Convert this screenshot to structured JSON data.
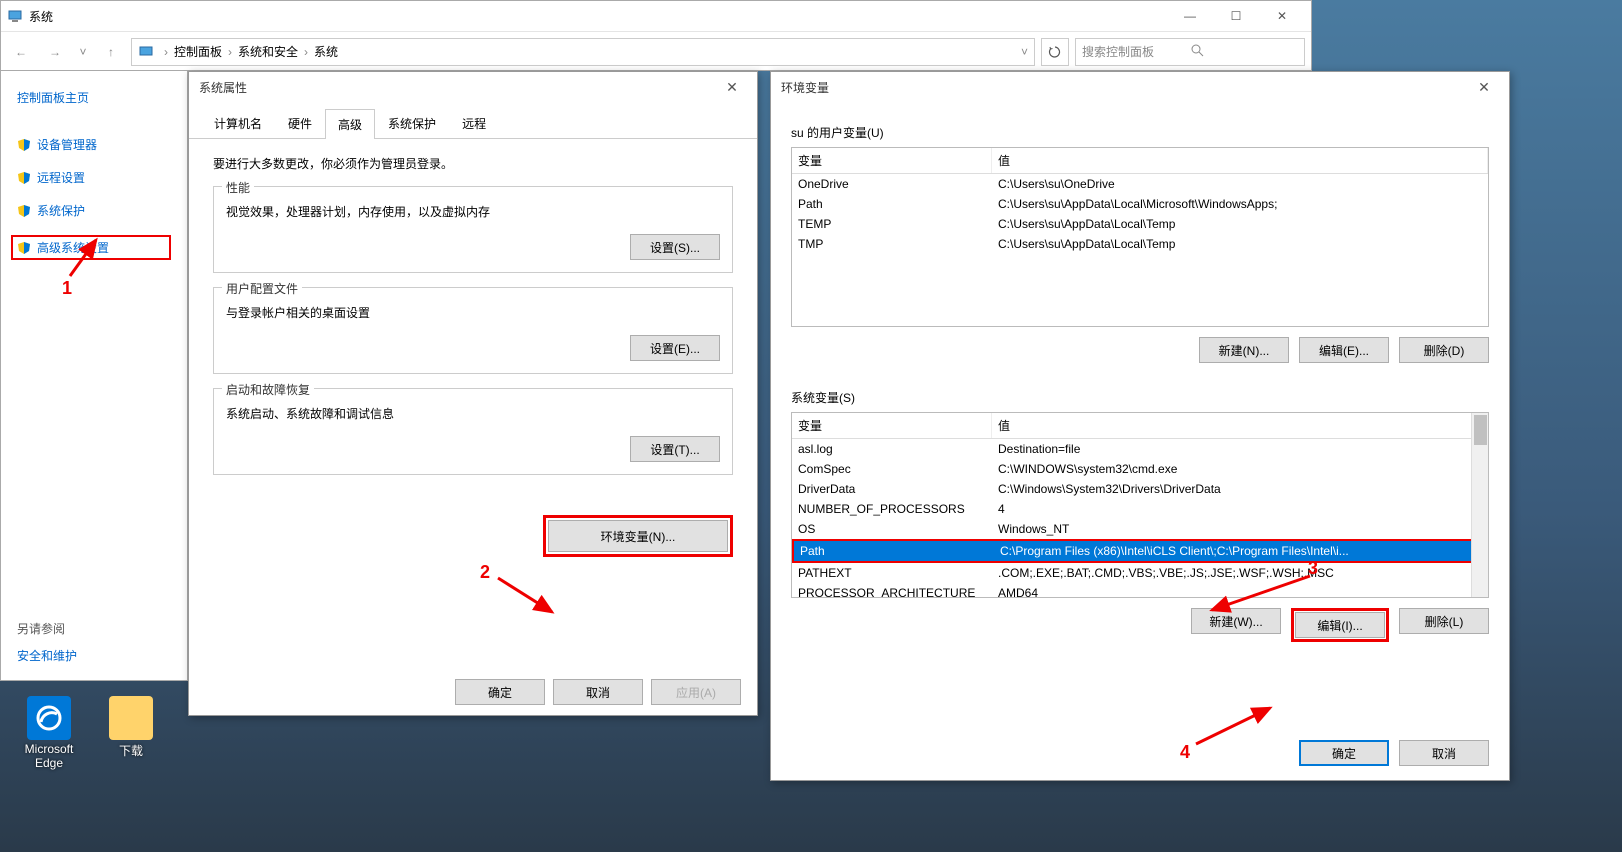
{
  "cp": {
    "title": "系统",
    "breadcrumb": [
      "控制面板",
      "系统和安全",
      "系统"
    ],
    "search_placeholder": "搜索控制面板"
  },
  "sidebar": {
    "home": "控制面板主页",
    "items": [
      {
        "label": "设备管理器"
      },
      {
        "label": "远程设置"
      },
      {
        "label": "系统保护"
      },
      {
        "label": "高级系统设置"
      }
    ],
    "footer_title": "另请参阅",
    "footer_link": "安全和维护"
  },
  "sp": {
    "title": "系统属性",
    "tabs": [
      "计算机名",
      "硬件",
      "高级",
      "系统保护",
      "远程"
    ],
    "note": "要进行大多数更改，你必须作为管理员登录。",
    "group1": {
      "legend": "性能",
      "desc": "视觉效果，处理器计划，内存使用，以及虚拟内存",
      "btn": "设置(S)..."
    },
    "group2": {
      "legend": "用户配置文件",
      "desc": "与登录帐户相关的桌面设置",
      "btn": "设置(E)..."
    },
    "group3": {
      "legend": "启动和故障恢复",
      "desc": "系统启动、系统故障和调试信息",
      "btn": "设置(T)..."
    },
    "env_btn": "环境变量(N)...",
    "ok": "确定",
    "cancel": "取消",
    "apply": "应用(A)"
  },
  "ev": {
    "title": "环境变量",
    "user_label": "su 的用户变量(U)",
    "sys_label": "系统变量(S)",
    "th_var": "变量",
    "th_val": "值",
    "user_rows": [
      {
        "var": "OneDrive",
        "val": "C:\\Users\\su\\OneDrive"
      },
      {
        "var": "Path",
        "val": "C:\\Users\\su\\AppData\\Local\\Microsoft\\WindowsApps;"
      },
      {
        "var": "TEMP",
        "val": "C:\\Users\\su\\AppData\\Local\\Temp"
      },
      {
        "var": "TMP",
        "val": "C:\\Users\\su\\AppData\\Local\\Temp"
      }
    ],
    "sys_rows": [
      {
        "var": "asl.log",
        "val": "Destination=file"
      },
      {
        "var": "ComSpec",
        "val": "C:\\WINDOWS\\system32\\cmd.exe"
      },
      {
        "var": "DriverData",
        "val": "C:\\Windows\\System32\\Drivers\\DriverData"
      },
      {
        "var": "NUMBER_OF_PROCESSORS",
        "val": "4"
      },
      {
        "var": "OS",
        "val": "Windows_NT"
      },
      {
        "var": "Path",
        "val": "C:\\Program Files (x86)\\Intel\\iCLS Client\\;C:\\Program Files\\Intel\\i..."
      },
      {
        "var": "PATHEXT",
        "val": ".COM;.EXE;.BAT;.CMD;.VBS;.VBE;.JS;.JSE;.WSF;.WSH;.MSC"
      },
      {
        "var": "PROCESSOR_ARCHITECTURE",
        "val": "AMD64"
      }
    ],
    "new_btn": "新建(N)...",
    "edit_btn": "编辑(E)...",
    "del_btn": "删除(D)",
    "new_btn2": "新建(W)...",
    "edit_btn2": "编辑(I)...",
    "del_btn2": "删除(L)",
    "ok": "确定",
    "cancel": "取消"
  },
  "desktop": {
    "edge": "Microsoft Edge",
    "downloads": "下载"
  },
  "anno": {
    "a1": "1",
    "a2": "2",
    "a3": "3",
    "a4": "4"
  }
}
